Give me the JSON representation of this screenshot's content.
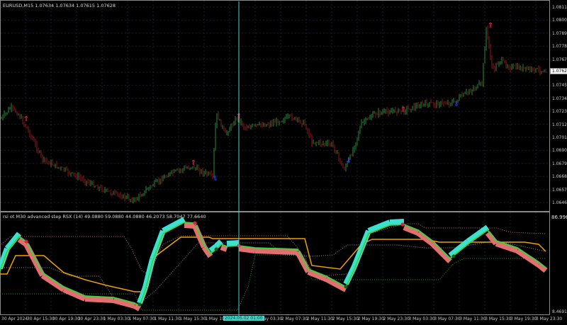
{
  "main_chart": {
    "title": "EURUSD,M15  1.07634 1.07634 1.07615 1.07628",
    "current_price": "1.07628",
    "price_labels": [
      "1.08110",
      "1.08000",
      "1.07890",
      "1.07780",
      "1.07670",
      "1.07560",
      "1.07450",
      "1.07340",
      "1.07230",
      "1.07120",
      "1.07010",
      "1.06900",
      "1.06790",
      "1.06680",
      "1.06570",
      "1.06460"
    ],
    "colors": {
      "bull": "#2fb34a",
      "bear": "#b0202a",
      "sell_signal": "#e0204a",
      "buy_signal": "#2030e0"
    }
  },
  "indicator": {
    "title": "rsi ot M30 advanced step RSX (14) 49.0880 59.0880 44.0880 46.2073 58.7047 77.6640",
    "max_label": "86.9962",
    "min_label": "8.4691",
    "colors": {
      "line": "#3ad43a",
      "up_fill": "#40e0d0",
      "down_fill": "#e07070",
      "step": "#f0a000",
      "upper_band": "#c07080",
      "lower_band": "#30a030",
      "mid_band": "#909090"
    }
  },
  "time_axis": {
    "labels": [
      "30 Apr 2024",
      "30 Apr 15:30",
      "30 Apr 19:30",
      "30 Apr 23:30",
      "1 May 03:30",
      "1 May 07:30",
      "1 May 11:30",
      "1 May 15:30",
      "1 May 19:30",
      "",
      "2 May 03:30",
      "2 May 07:30",
      "2 May 11:30",
      "2 May 15:30",
      "2 May 19:30",
      "2 May 23:30",
      "3 May 03:30",
      "3 May 07:30",
      "3 May 11:30",
      "3 May 15:30",
      "3 May 19:30",
      "3 May 23:30"
    ],
    "crosshair_label": "2024.05.02 01:00"
  }
}
